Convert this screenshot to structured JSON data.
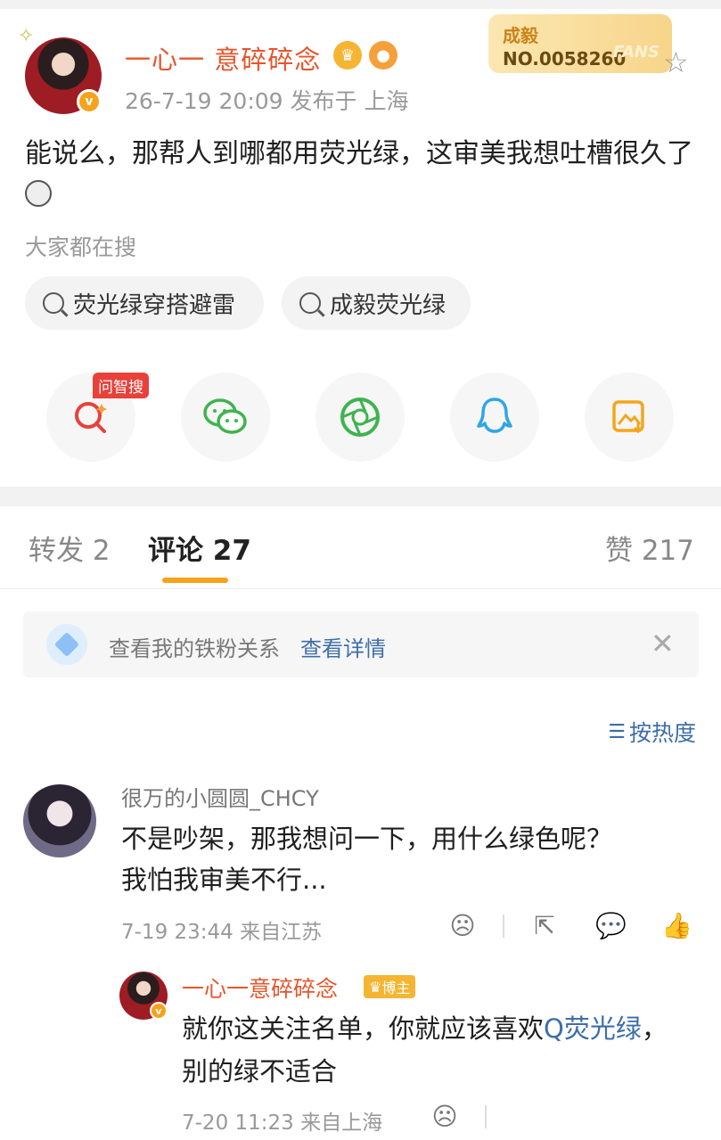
{
  "post": {
    "author_name": "一心一  意碎碎念",
    "meta": "26-7-19 20:09  发布于 上海",
    "text": "能说么，那帮人到哪都用荧光绿，这审美我想吐槽很久了",
    "fans_card": {
      "name": "成毅",
      "number": "NO.0058260",
      "watermark": "FANS"
    },
    "search_label": "大家都在搜",
    "search_chips": [
      "荧光绿穿搭避雷",
      "成毅荧光绿"
    ],
    "ai_search_badge": "问智搜",
    "share_icons": [
      "ai-search-icon",
      "wechat-icon",
      "moments-icon",
      "qq-icon",
      "save-image-icon"
    ]
  },
  "tabs": {
    "repost": "转发 2",
    "comments": "评论 27",
    "likes": "赞 217"
  },
  "fans_banner": {
    "text": "查看我的铁粉关系",
    "link": "查看详情"
  },
  "sort_label": "按热度",
  "comments": [
    {
      "name": "很万的小圆圆_CHCY",
      "text_line1": "不是吵架，那我想问一下，用什么绿色呢？",
      "text_line2": "我怕我审美不行...",
      "meta": "7-19 23:44  来自江苏",
      "reply": {
        "name": "一心一意碎碎念",
        "badge": "博主",
        "text_before": "就你这关注名单，你就应该喜欢",
        "link": "Q荧光绿",
        "text_after": "，别的绿不适合",
        "meta": "7-20 11:23  来自上海"
      }
    }
  ],
  "colors": {
    "accent_orange": "#f7a21b",
    "name_orange": "#e7552b",
    "link_blue": "#3d6ea9"
  }
}
